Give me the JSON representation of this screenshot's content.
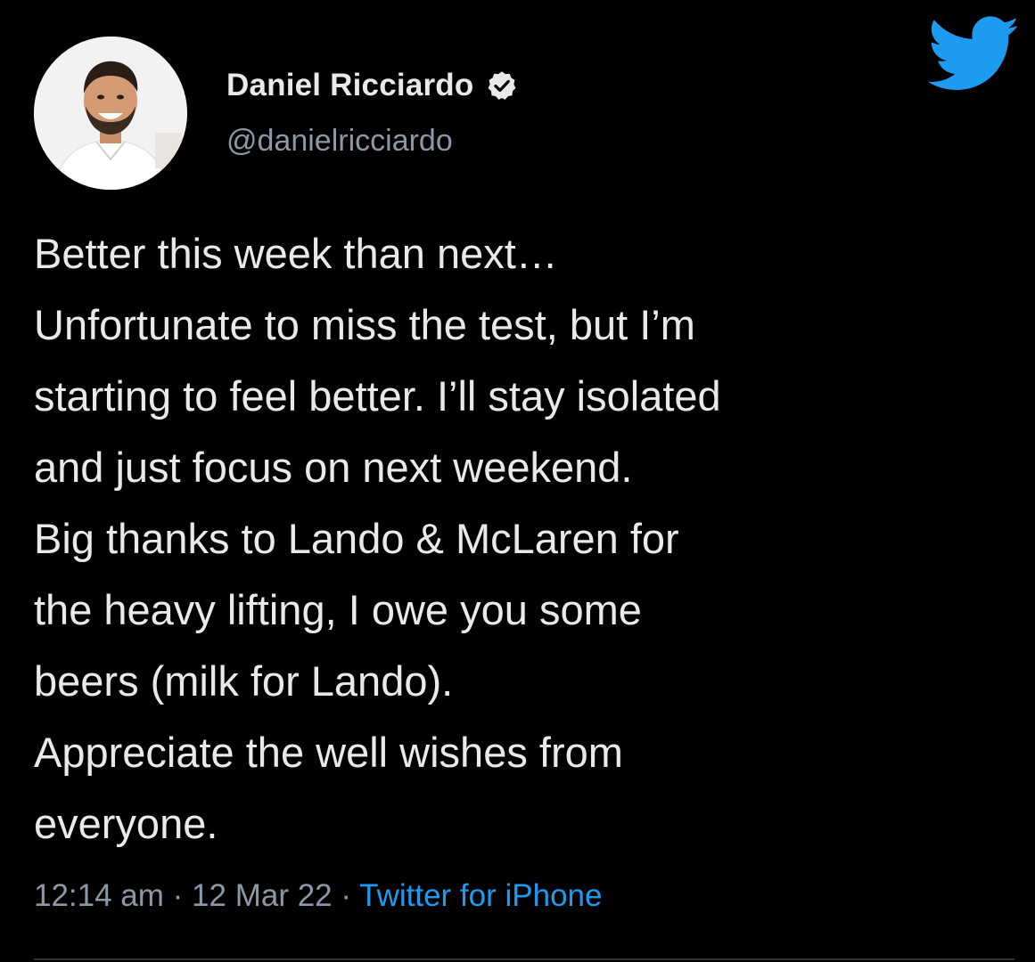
{
  "author": {
    "display_name": "Daniel Ricciardo",
    "handle": "@danielricciardo",
    "verified": true
  },
  "tweet": {
    "lines": [
      "Better this week than next…",
      "Unfortunate to miss the test, but I’m",
      "starting to feel better. I’ll stay isolated",
      "and just focus on next weekend.",
      "Big thanks to Lando & McLaren for",
      "the heavy lifting, I owe you some",
      "beers (milk for Lando).",
      "Appreciate the well wishes from",
      "everyone."
    ]
  },
  "meta": {
    "time": "12:14 am",
    "separator": " · ",
    "date": "12 Mar 22",
    "source": "Twitter for iPhone"
  },
  "icons": {
    "logo": "twitter-bird-icon",
    "verified": "verified-badge-icon"
  },
  "colors": {
    "background": "#000000",
    "text": "#e7e9ea",
    "secondary_text": "#8b98a5",
    "accent": "#1d9bf0"
  }
}
